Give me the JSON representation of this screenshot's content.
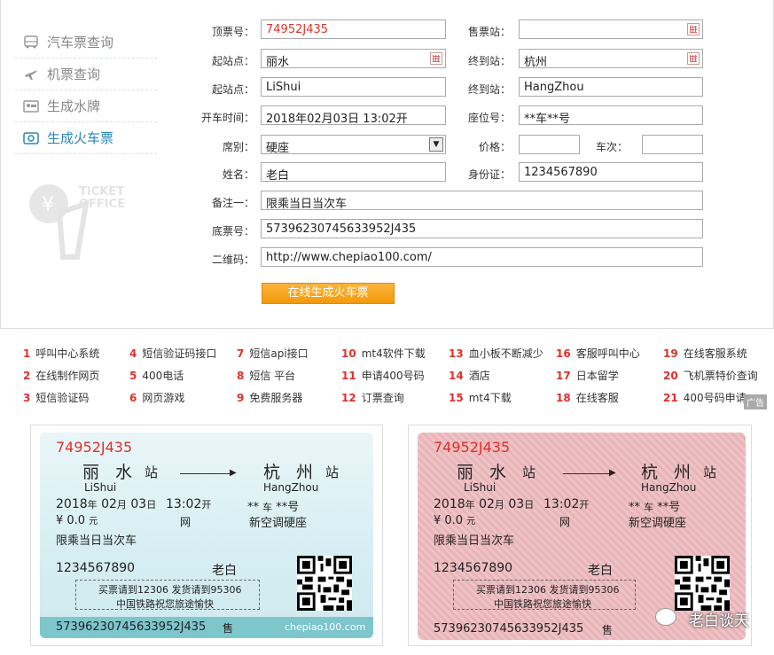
{
  "sidebar": {
    "items": [
      {
        "label": "汽车票查询",
        "icon": "bus-icon"
      },
      {
        "label": "机票查询",
        "icon": "plane-icon"
      },
      {
        "label": "生成水牌",
        "icon": "sign-icon"
      },
      {
        "label": "生成火车票",
        "icon": "ticket-icon"
      }
    ],
    "logo_text_1": "TICKET",
    "logo_text_2": "OFFICE"
  },
  "form": {
    "ticket_no_label": "顶票号：",
    "ticket_no": "74952J435",
    "sale_station_label": "售票站：",
    "sale_station": "",
    "from_label": "起站点：",
    "from": "丽水",
    "to_label": "终到站：",
    "to": "杭州",
    "from_en_label": "起站点：",
    "from_en": "LiShui",
    "to_en_label": "终到站：",
    "to_en": "HangZhou",
    "depart_time_label": "开车时间：",
    "depart_time": "2018年02月03日 13:02开",
    "seat_no_label": "座位号：",
    "seat_no": "**车**号",
    "seat_type_label": "席别：",
    "seat_type": "硬座",
    "price_label": "价格：",
    "price": "",
    "train_label": "车次：",
    "train": "",
    "name_label": "姓名：",
    "name": "老白",
    "id_label": "身份证：",
    "id": "1234567890",
    "note_label": "备注一：",
    "note": "限乘当日当次车",
    "bottom_no_label": "底票号：",
    "bottom_no": "573962307456339​52J435",
    "qr_label": "二维码：",
    "qr": "http://www.chepiao100.com/",
    "generate_button": "在线生成火车票"
  },
  "links": [
    {
      "n": "1",
      "t": "呼叫中心系统"
    },
    {
      "n": "4",
      "t": "短信验证码接口"
    },
    {
      "n": "7",
      "t": "短信api接口"
    },
    {
      "n": "10",
      "t": "mt4软件下载"
    },
    {
      "n": "13",
      "t": "血小板不断减少"
    },
    {
      "n": "16",
      "t": "客服呼叫中心"
    },
    {
      "n": "19",
      "t": "在线客服系统"
    },
    {
      "n": "2",
      "t": "在线制作网页"
    },
    {
      "n": "5",
      "t": "400电话"
    },
    {
      "n": "8",
      "t": "短信 平台"
    },
    {
      "n": "11",
      "t": "申请400号码"
    },
    {
      "n": "14",
      "t": "酒店"
    },
    {
      "n": "17",
      "t": "日本留学"
    },
    {
      "n": "20",
      "t": "飞机票特价查询"
    },
    {
      "n": "3",
      "t": "短信验证码"
    },
    {
      "n": "6",
      "t": "网页游戏"
    },
    {
      "n": "9",
      "t": "免费服务器"
    },
    {
      "n": "12",
      "t": "订票查询"
    },
    {
      "n": "15",
      "t": "mt4下载"
    },
    {
      "n": "18",
      "t": "在线客服"
    },
    {
      "n": "21",
      "t": "400号码申请"
    }
  ],
  "ad_label": "广告",
  "ticket": {
    "number": "74952J435",
    "from": "丽 水",
    "station": "站",
    "from_en": "LiShui",
    "to": "杭 州",
    "to_en": "HangZhou",
    "year": "2018",
    "nian": "年",
    "month": "02",
    "yue": "月",
    "day": "03",
    "ri": "日",
    "time": "13:02",
    "kai": "开",
    "seat_car": "**",
    "che": "车",
    "seat_num": "**",
    "hao": "号",
    "wang": "网",
    "price": "¥ 0.0",
    "yuan": "元",
    "seat_type": "新空调硬座",
    "note": "限乘当日当次车",
    "id": "1234567890",
    "name": "老白",
    "box_line1": "买票请到12306 发货请到95306",
    "box_line2": "中国铁路祝您旅途愉快",
    "bottom_no": "57396230745633952J435",
    "shou": "售",
    "site": "chepiao100.com"
  },
  "watermark": "老白谈天",
  "colors": {
    "accent": "#2a87b8",
    "red": "#e0302a",
    "button": "#f39a0b"
  }
}
